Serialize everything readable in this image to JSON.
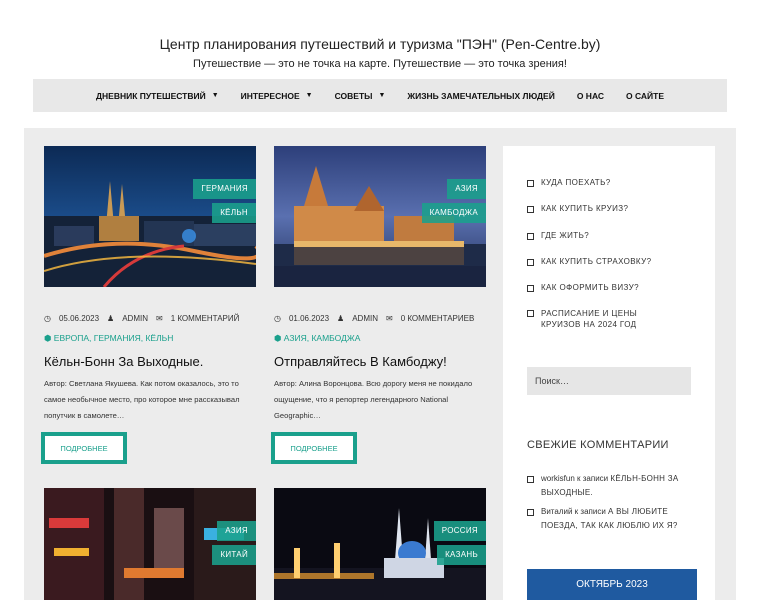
{
  "header": {
    "title": "Центр планирования путешествий и туризма \"ПЭН\" (Pen-Centre.by)",
    "tagline": "Путешествие — это не точка на карте. Путешествие — это точка зрения!"
  },
  "nav": {
    "items": [
      {
        "label": "Дневник путешествий",
        "has_dropdown": true
      },
      {
        "label": "Интересное",
        "has_dropdown": true
      },
      {
        "label": "Советы",
        "has_dropdown": true
      },
      {
        "label": "Жизнь замечательных людей",
        "has_dropdown": false
      },
      {
        "label": "О нас",
        "has_dropdown": false
      },
      {
        "label": "О сайте",
        "has_dropdown": false
      }
    ],
    "caret": "▼"
  },
  "posts": [
    {
      "tags": [
        "Германия",
        "Кёльн"
      ],
      "date": "05.06.2023",
      "author": "ADMIN",
      "comments": "1 КОММЕНТАРИЙ",
      "categories": "Европа, Германия, Кёльн",
      "title": "Кёльн-Бонн За Выходные.",
      "excerpt": "Автор: Светлана Якушева. Как потом оказалось, это то самое необычное место, про которое мне рассказывал попутчик в самолете…",
      "more_label": "Подробнее"
    },
    {
      "tags": [
        "Азия",
        "Камбоджа"
      ],
      "date": "01.06.2023",
      "author": "ADMIN",
      "comments": "0 КОММЕНТАРИЕВ",
      "categories": "Азия, Камбоджа",
      "title": "Отправляйтесь В Камбоджу!",
      "excerpt": "Автор: Алина Воронцова. Всю дорогу меня не покидало ощущение, что я репортер легендарного National Geographic…",
      "more_label": "Подробнее"
    },
    {
      "tags": [
        "Азия",
        "Китай"
      ]
    },
    {
      "tags": [
        "Россия",
        "Казань"
      ]
    }
  ],
  "sidebar": {
    "links": [
      "Куда поехать?",
      "Как купить круиз?",
      "Где жить?",
      "Как купить страховку?",
      "Как оформить визу?",
      "Расписание и цены круизов на 2024 год"
    ],
    "search_placeholder": "Поиск…",
    "comments_heading": "Свежие комментарии",
    "comments": [
      {
        "author": "workisfun",
        "connector": "к записи",
        "post": "Кёльн-Бонн за выходные."
      },
      {
        "author": "Виталий",
        "connector": "к записи",
        "post": "А вы любите поезда, так как люблю их я?"
      }
    ],
    "calendar_title": "Октябрь 2023"
  },
  "colors": {
    "accent": "#1aa08c",
    "nav_bg": "#e8e8e8",
    "content_bg": "#ececec",
    "calendar_bg": "#1f5aa0"
  }
}
